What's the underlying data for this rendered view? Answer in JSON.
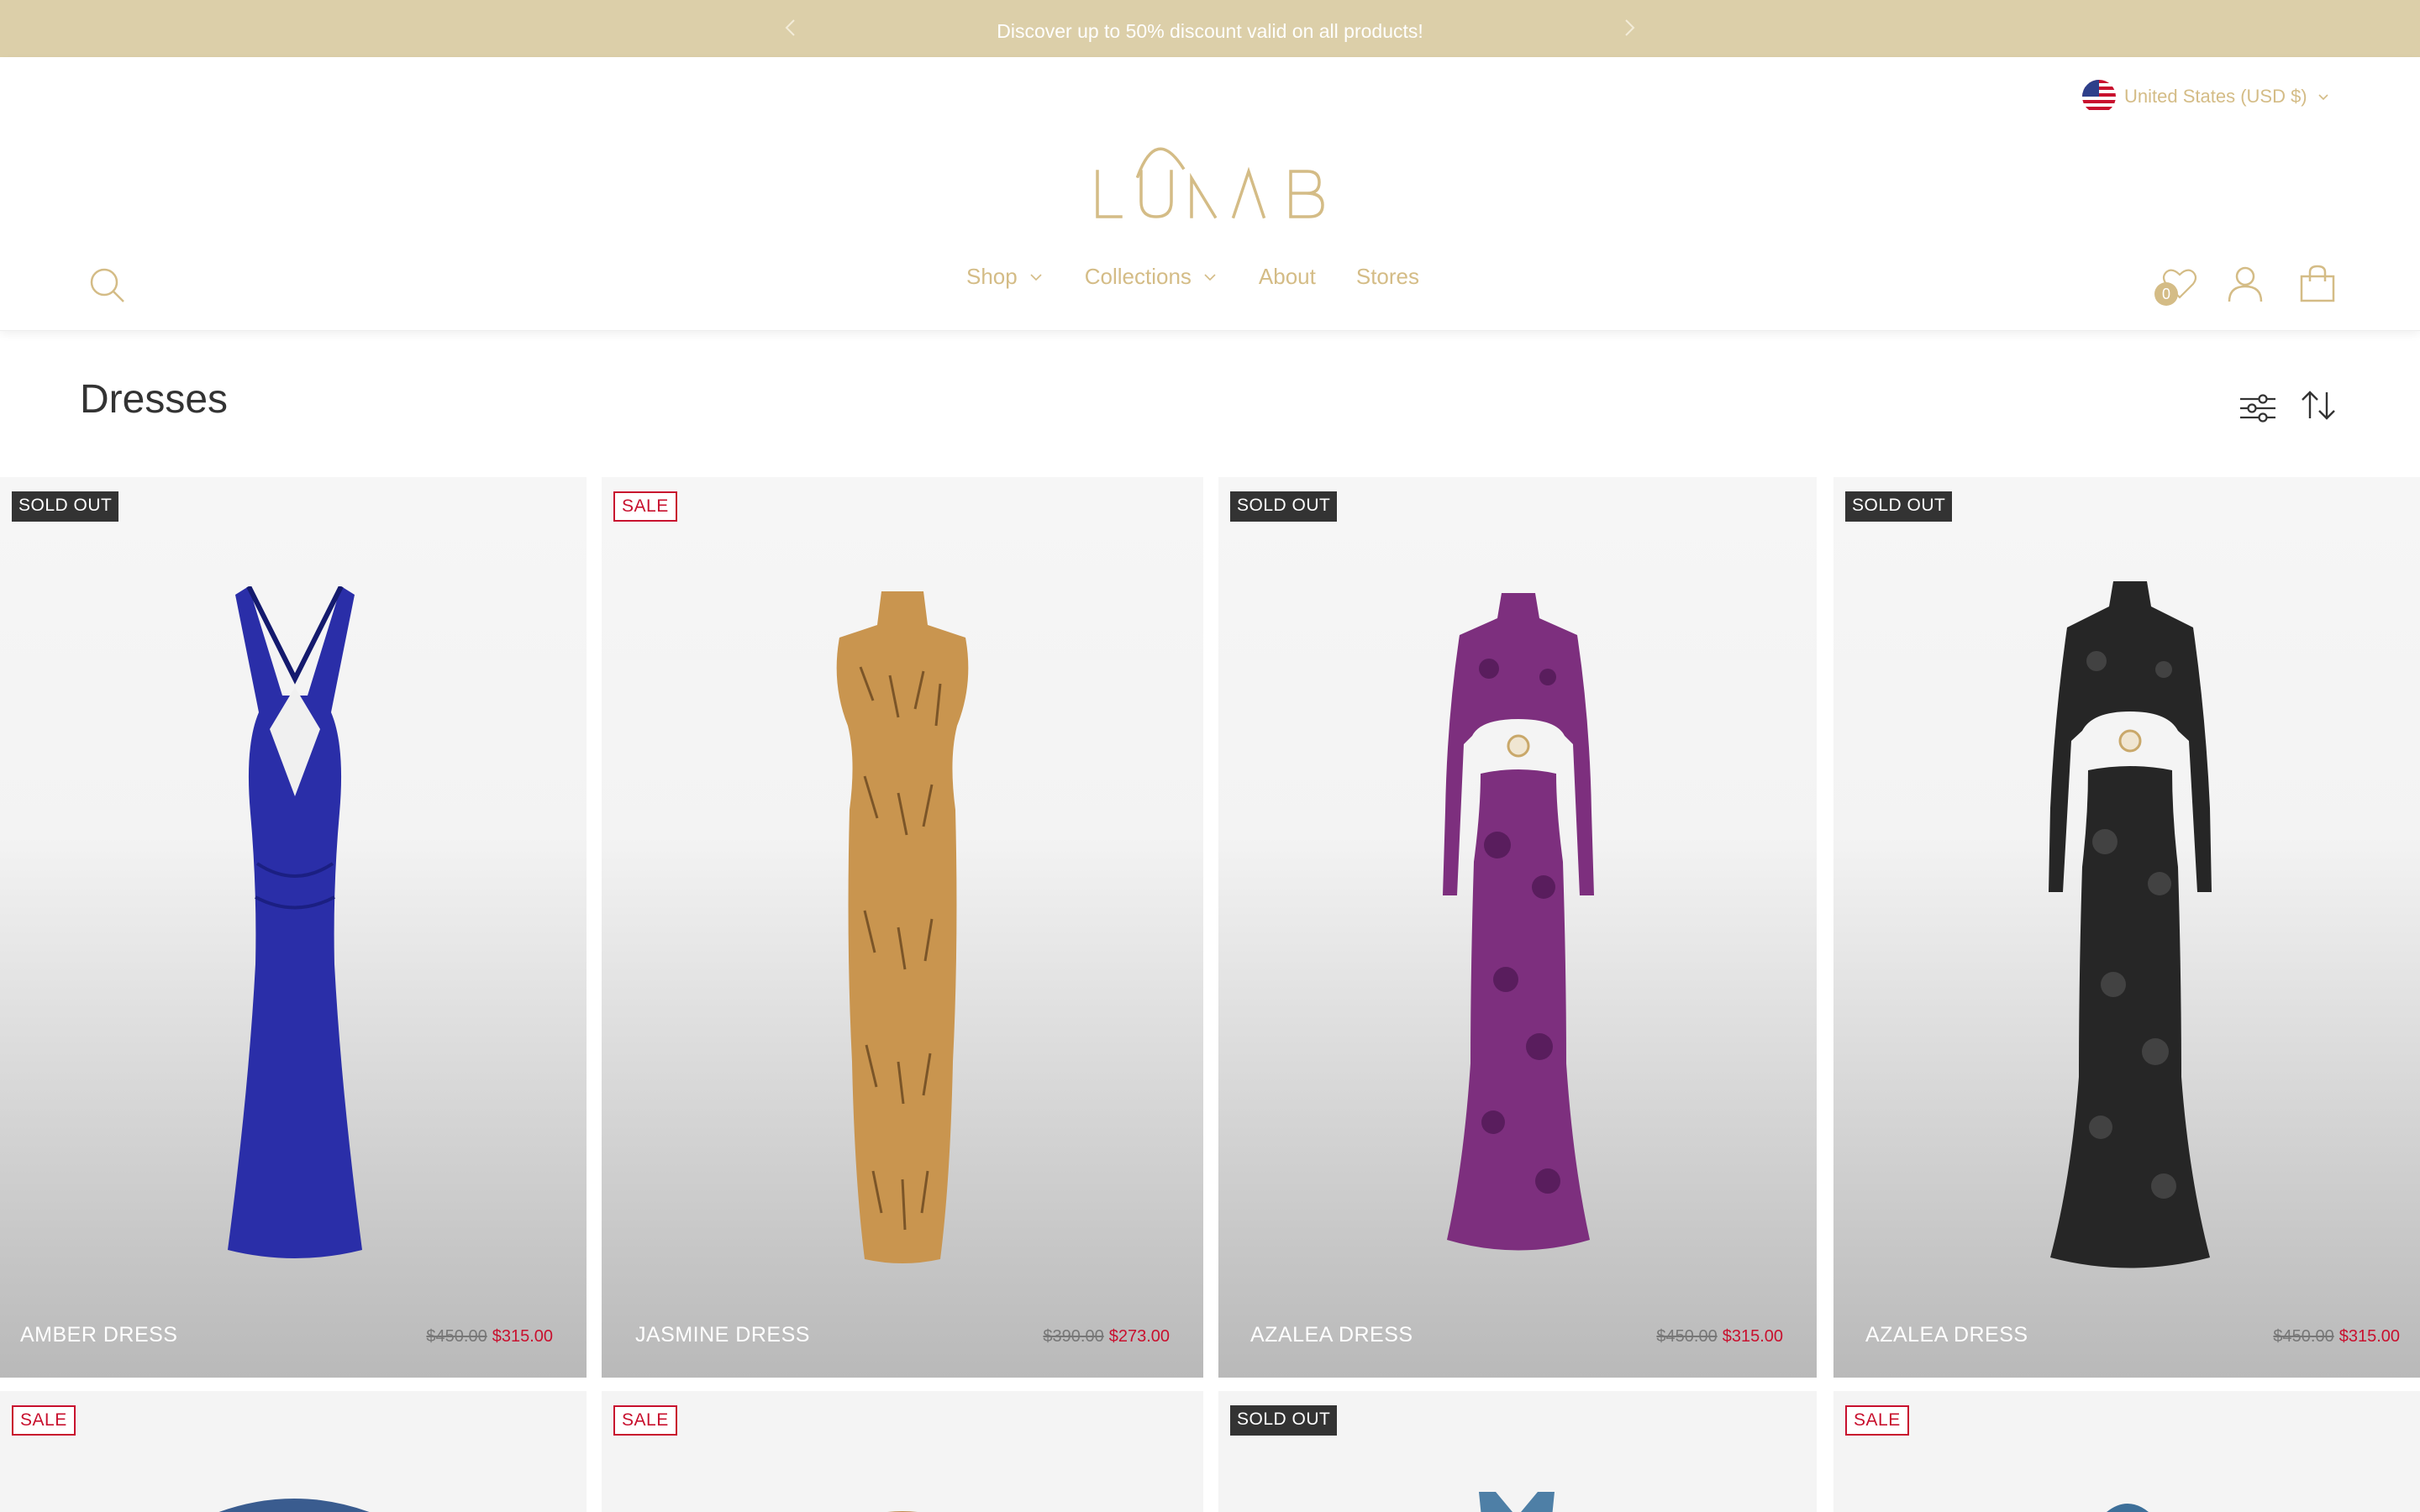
{
  "announcement": {
    "text": "Discover up to 50% discount valid on all products!",
    "prev_icon": "chevron-left-icon",
    "next_icon": "chevron-right-icon"
  },
  "header": {
    "locale": "United States (USD $)",
    "logo_text": "LUNAB",
    "nav": [
      {
        "label": "Shop",
        "has_dropdown": true
      },
      {
        "label": "Collections",
        "has_dropdown": true
      },
      {
        "label": "About",
        "has_dropdown": false
      },
      {
        "label": "Stores",
        "has_dropdown": false
      }
    ],
    "wishlist_count": "0",
    "icons": [
      "search-icon",
      "heart-icon",
      "user-icon",
      "bag-icon"
    ]
  },
  "page": {
    "title": "Dresses",
    "tools": [
      "filter-icon",
      "sort-icon"
    ]
  },
  "products": [
    {
      "badge": "SOLD OUT",
      "badge_type": "sold",
      "name": "AMBER DRESS",
      "old_price": "$450.00",
      "price": "$315.00",
      "color": "#2a2ea8"
    },
    {
      "badge": "SALE",
      "badge_type": "sale",
      "name": "JASMINE DRESS",
      "old_price": "$390.00",
      "price": "$273.00",
      "color": "#c9954f"
    },
    {
      "badge": "SOLD OUT",
      "badge_type": "sold",
      "name": "AZALEA DRESS",
      "old_price": "$450.00",
      "price": "$315.00",
      "color": "#7d2f7e"
    },
    {
      "badge": "SOLD OUT",
      "badge_type": "sold",
      "name": "AZALEA DRESS",
      "old_price": "$450.00",
      "price": "$315.00",
      "color": "#262626"
    },
    {
      "badge": "SALE",
      "badge_type": "sale",
      "color": "#3a5c8f"
    },
    {
      "badge": "SALE",
      "badge_type": "sale",
      "color": "#c08a4c"
    },
    {
      "badge": "SOLD OUT",
      "badge_type": "sold",
      "color": "#4e7fa6"
    },
    {
      "badge": "SALE",
      "badge_type": "sale",
      "color": "#3d6f99"
    }
  ],
  "colors": {
    "announcement_bg": "#dccfa9",
    "brand_gold": "#d4bc86",
    "sale_red": "#c8102e",
    "sold_badge_bg": "#333333"
  }
}
